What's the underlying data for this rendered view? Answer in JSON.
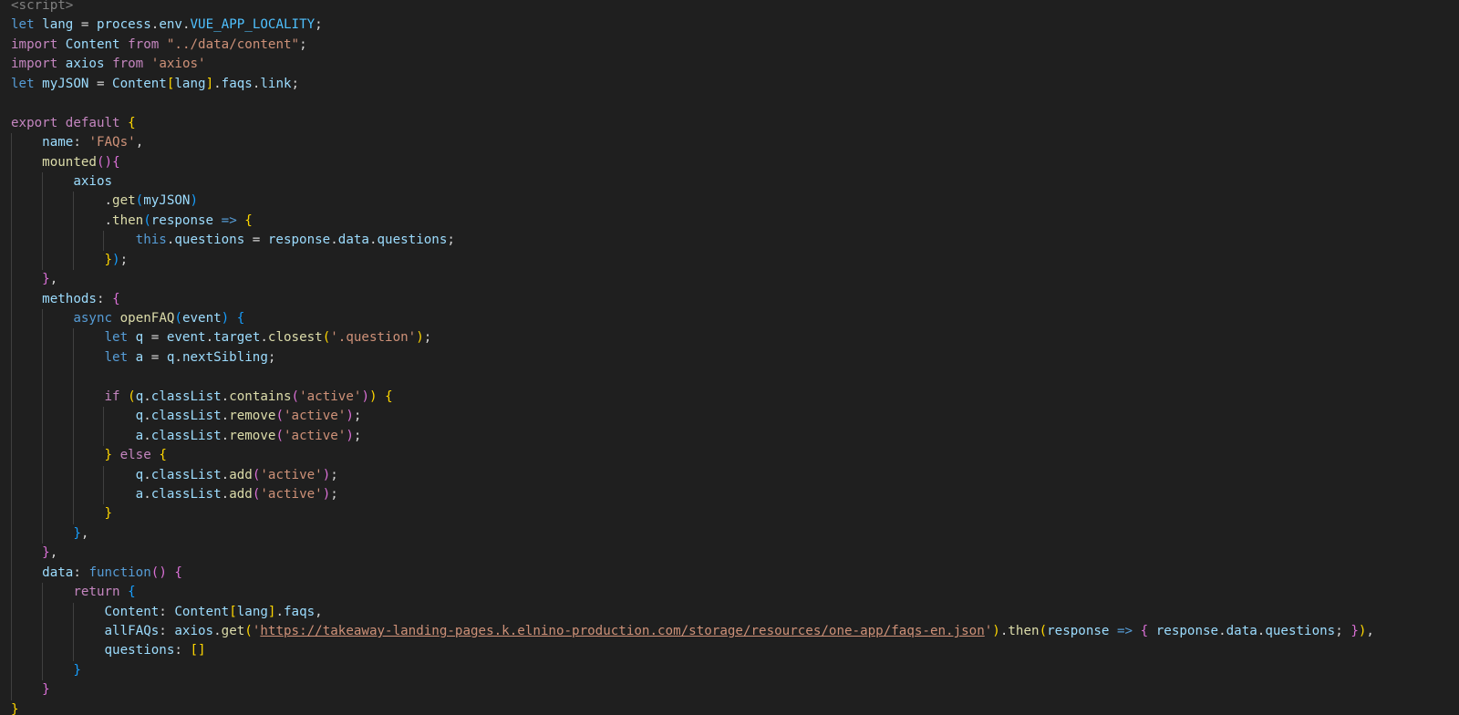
{
  "theme": {
    "background": "#1f1f1f",
    "colors": {
      "keyword": "#569cd6",
      "control": "#c586c0",
      "variable": "#9cdcfe",
      "class": "#4ec9b0",
      "function": "#dcdcaa",
      "string": "#ce9178",
      "constant": "#4fc1ff",
      "bracket_level_1": "#ffd700",
      "bracket_level_2": "#da70d6",
      "bracket_level_3": "#179fff"
    }
  },
  "code": {
    "lines": [
      {
        "indent": 0,
        "tokens": [
          [
            "tag",
            "<script>"
          ]
        ]
      },
      {
        "indent": 0,
        "tokens": [
          [
            "kw",
            "let"
          ],
          [
            "op",
            " "
          ],
          [
            "var",
            "lang"
          ],
          [
            "op",
            " = "
          ],
          [
            "var",
            "process"
          ],
          [
            "op",
            "."
          ],
          [
            "var",
            "env"
          ],
          [
            "op",
            "."
          ],
          [
            "const",
            "VUE_APP_LOCALITY"
          ],
          [
            "op",
            ";"
          ]
        ]
      },
      {
        "indent": 0,
        "tokens": [
          [
            "ctl",
            "import"
          ],
          [
            "op",
            " "
          ],
          [
            "var",
            "Content"
          ],
          [
            "op",
            " "
          ],
          [
            "ctl",
            "from"
          ],
          [
            "op",
            " "
          ],
          [
            "str",
            "\"../data/content\""
          ],
          [
            "op",
            ";"
          ]
        ]
      },
      {
        "indent": 0,
        "tokens": [
          [
            "ctl",
            "import"
          ],
          [
            "op",
            " "
          ],
          [
            "var",
            "axios"
          ],
          [
            "op",
            " "
          ],
          [
            "ctl",
            "from"
          ],
          [
            "op",
            " "
          ],
          [
            "str",
            "'axios'"
          ]
        ]
      },
      {
        "indent": 0,
        "tokens": [
          [
            "kw",
            "let"
          ],
          [
            "op",
            " "
          ],
          [
            "var",
            "myJSON"
          ],
          [
            "op",
            " = "
          ],
          [
            "var",
            "Content"
          ],
          [
            "b1",
            "["
          ],
          [
            "var",
            "lang"
          ],
          [
            "b1",
            "]"
          ],
          [
            "op",
            "."
          ],
          [
            "var",
            "faqs"
          ],
          [
            "op",
            "."
          ],
          [
            "var",
            "link"
          ],
          [
            "op",
            ";"
          ]
        ]
      },
      {
        "indent": 0,
        "tokens": []
      },
      {
        "indent": 0,
        "tokens": [
          [
            "ctl",
            "export"
          ],
          [
            "op",
            " "
          ],
          [
            "ctl",
            "default"
          ],
          [
            "op",
            " "
          ],
          [
            "b1",
            "{"
          ]
        ]
      },
      {
        "indent": 1,
        "tokens": [
          [
            "var",
            "name"
          ],
          [
            "op",
            ": "
          ],
          [
            "str",
            "'FAQs'"
          ],
          [
            "op",
            ","
          ]
        ]
      },
      {
        "indent": 1,
        "tokens": [
          [
            "fn",
            "mounted"
          ],
          [
            "b2",
            "()"
          ],
          [
            "b2",
            "{"
          ]
        ]
      },
      {
        "indent": 2,
        "tokens": [
          [
            "var",
            "axios"
          ]
        ]
      },
      {
        "indent": 3,
        "tokens": [
          [
            "op",
            "."
          ],
          [
            "fn",
            "get"
          ],
          [
            "b3",
            "("
          ],
          [
            "var",
            "myJSON"
          ],
          [
            "b3",
            ")"
          ]
        ]
      },
      {
        "indent": 3,
        "tokens": [
          [
            "op",
            "."
          ],
          [
            "fn",
            "then"
          ],
          [
            "b3",
            "("
          ],
          [
            "var",
            "response"
          ],
          [
            "op",
            " "
          ],
          [
            "kw",
            "=>"
          ],
          [
            "op",
            " "
          ],
          [
            "b1",
            "{"
          ]
        ]
      },
      {
        "indent": 4,
        "tokens": [
          [
            "kw",
            "this"
          ],
          [
            "op",
            "."
          ],
          [
            "var",
            "questions"
          ],
          [
            "op",
            " = "
          ],
          [
            "var",
            "response"
          ],
          [
            "op",
            "."
          ],
          [
            "var",
            "data"
          ],
          [
            "op",
            "."
          ],
          [
            "var",
            "questions"
          ],
          [
            "op",
            ";"
          ]
        ]
      },
      {
        "indent": 3,
        "tokens": [
          [
            "b1",
            "}"
          ],
          [
            "b3",
            ")"
          ],
          [
            "op",
            ";"
          ]
        ]
      },
      {
        "indent": 1,
        "tokens": [
          [
            "b2",
            "}"
          ],
          [
            "op",
            ","
          ]
        ]
      },
      {
        "indent": 1,
        "tokens": [
          [
            "var",
            "methods"
          ],
          [
            "op",
            ": "
          ],
          [
            "b2",
            "{"
          ]
        ]
      },
      {
        "indent": 2,
        "tokens": [
          [
            "kw",
            "async"
          ],
          [
            "op",
            " "
          ],
          [
            "fn",
            "openFAQ"
          ],
          [
            "b3",
            "("
          ],
          [
            "var",
            "event"
          ],
          [
            "b3",
            ")"
          ],
          [
            "op",
            " "
          ],
          [
            "b3",
            "{"
          ]
        ]
      },
      {
        "indent": 3,
        "tokens": [
          [
            "kw",
            "let"
          ],
          [
            "op",
            " "
          ],
          [
            "var",
            "q"
          ],
          [
            "op",
            " = "
          ],
          [
            "var",
            "event"
          ],
          [
            "op",
            "."
          ],
          [
            "var",
            "target"
          ],
          [
            "op",
            "."
          ],
          [
            "fn",
            "closest"
          ],
          [
            "b1",
            "("
          ],
          [
            "str",
            "'.question'"
          ],
          [
            "b1",
            ")"
          ],
          [
            "op",
            ";"
          ]
        ]
      },
      {
        "indent": 3,
        "tokens": [
          [
            "kw",
            "let"
          ],
          [
            "op",
            " "
          ],
          [
            "var",
            "a"
          ],
          [
            "op",
            " = "
          ],
          [
            "var",
            "q"
          ],
          [
            "op",
            "."
          ],
          [
            "var",
            "nextSibling"
          ],
          [
            "op",
            ";"
          ]
        ]
      },
      {
        "indent": 3,
        "tokens": []
      },
      {
        "indent": 3,
        "tokens": [
          [
            "ctl",
            "if"
          ],
          [
            "op",
            " "
          ],
          [
            "b1",
            "("
          ],
          [
            "var",
            "q"
          ],
          [
            "op",
            "."
          ],
          [
            "var",
            "classList"
          ],
          [
            "op",
            "."
          ],
          [
            "fn",
            "contains"
          ],
          [
            "b2",
            "("
          ],
          [
            "str",
            "'active'"
          ],
          [
            "b2",
            ")"
          ],
          [
            "b1",
            ")"
          ],
          [
            "op",
            " "
          ],
          [
            "b1",
            "{"
          ]
        ]
      },
      {
        "indent": 4,
        "tokens": [
          [
            "var",
            "q"
          ],
          [
            "op",
            "."
          ],
          [
            "var",
            "classList"
          ],
          [
            "op",
            "."
          ],
          [
            "fn",
            "remove"
          ],
          [
            "b2",
            "("
          ],
          [
            "str",
            "'active'"
          ],
          [
            "b2",
            ")"
          ],
          [
            "op",
            ";"
          ]
        ]
      },
      {
        "indent": 4,
        "tokens": [
          [
            "var",
            "a"
          ],
          [
            "op",
            "."
          ],
          [
            "var",
            "classList"
          ],
          [
            "op",
            "."
          ],
          [
            "fn",
            "remove"
          ],
          [
            "b2",
            "("
          ],
          [
            "str",
            "'active'"
          ],
          [
            "b2",
            ")"
          ],
          [
            "op",
            ";"
          ]
        ]
      },
      {
        "indent": 3,
        "tokens": [
          [
            "b1",
            "}"
          ],
          [
            "op",
            " "
          ],
          [
            "ctl",
            "else"
          ],
          [
            "op",
            " "
          ],
          [
            "b1",
            "{"
          ]
        ]
      },
      {
        "indent": 4,
        "tokens": [
          [
            "var",
            "q"
          ],
          [
            "op",
            "."
          ],
          [
            "var",
            "classList"
          ],
          [
            "op",
            "."
          ],
          [
            "fn",
            "add"
          ],
          [
            "b2",
            "("
          ],
          [
            "str",
            "'active'"
          ],
          [
            "b2",
            ")"
          ],
          [
            "op",
            ";"
          ]
        ]
      },
      {
        "indent": 4,
        "tokens": [
          [
            "var",
            "a"
          ],
          [
            "op",
            "."
          ],
          [
            "var",
            "classList"
          ],
          [
            "op",
            "."
          ],
          [
            "fn",
            "add"
          ],
          [
            "b2",
            "("
          ],
          [
            "str",
            "'active'"
          ],
          [
            "b2",
            ")"
          ],
          [
            "op",
            ";"
          ]
        ]
      },
      {
        "indent": 3,
        "tokens": [
          [
            "b1",
            "}"
          ]
        ]
      },
      {
        "indent": 2,
        "tokens": [
          [
            "b3",
            "}"
          ],
          [
            "op",
            ","
          ]
        ]
      },
      {
        "indent": 1,
        "tokens": [
          [
            "b2",
            "}"
          ],
          [
            "op",
            ","
          ]
        ]
      },
      {
        "indent": 1,
        "tokens": [
          [
            "var",
            "data"
          ],
          [
            "op",
            ": "
          ],
          [
            "kw",
            "function"
          ],
          [
            "b2",
            "()"
          ],
          [
            "op",
            " "
          ],
          [
            "b2",
            "{"
          ]
        ]
      },
      {
        "indent": 2,
        "tokens": [
          [
            "ctl",
            "return"
          ],
          [
            "op",
            " "
          ],
          [
            "b3",
            "{"
          ]
        ]
      },
      {
        "indent": 3,
        "tokens": [
          [
            "var",
            "Content"
          ],
          [
            "op",
            ": "
          ],
          [
            "var",
            "Content"
          ],
          [
            "b1",
            "["
          ],
          [
            "var",
            "lang"
          ],
          [
            "b1",
            "]"
          ],
          [
            "op",
            "."
          ],
          [
            "var",
            "faqs"
          ],
          [
            "op",
            ","
          ]
        ]
      },
      {
        "indent": 3,
        "tokens": [
          [
            "var",
            "allFAQs"
          ],
          [
            "op",
            ": "
          ],
          [
            "var",
            "axios"
          ],
          [
            "op",
            "."
          ],
          [
            "fn",
            "get"
          ],
          [
            "b1",
            "("
          ],
          [
            "str",
            "'"
          ],
          [
            "url",
            "https://takeaway-landing-pages.k.elnino-production.com/storage/resources/one-app/faqs-en.json"
          ],
          [
            "str",
            "'"
          ],
          [
            "b1",
            ")"
          ],
          [
            "op",
            "."
          ],
          [
            "fn",
            "then"
          ],
          [
            "b1",
            "("
          ],
          [
            "var",
            "response"
          ],
          [
            "op",
            " "
          ],
          [
            "kw",
            "=>"
          ],
          [
            "op",
            " "
          ],
          [
            "b2",
            "{"
          ],
          [
            "op",
            " "
          ],
          [
            "var",
            "response"
          ],
          [
            "op",
            "."
          ],
          [
            "var",
            "data"
          ],
          [
            "op",
            "."
          ],
          [
            "var",
            "questions"
          ],
          [
            "op",
            "; "
          ],
          [
            "b2",
            "}"
          ],
          [
            "b1",
            ")"
          ],
          [
            "op",
            ","
          ]
        ]
      },
      {
        "indent": 3,
        "tokens": [
          [
            "var",
            "questions"
          ],
          [
            "op",
            ": "
          ],
          [
            "b1",
            "[]"
          ]
        ]
      },
      {
        "indent": 2,
        "tokens": [
          [
            "b3",
            "}"
          ]
        ]
      },
      {
        "indent": 1,
        "tokens": [
          [
            "b2",
            "}"
          ]
        ]
      },
      {
        "indent": 0,
        "tokens": [
          [
            "b1",
            "}"
          ]
        ]
      }
    ]
  }
}
